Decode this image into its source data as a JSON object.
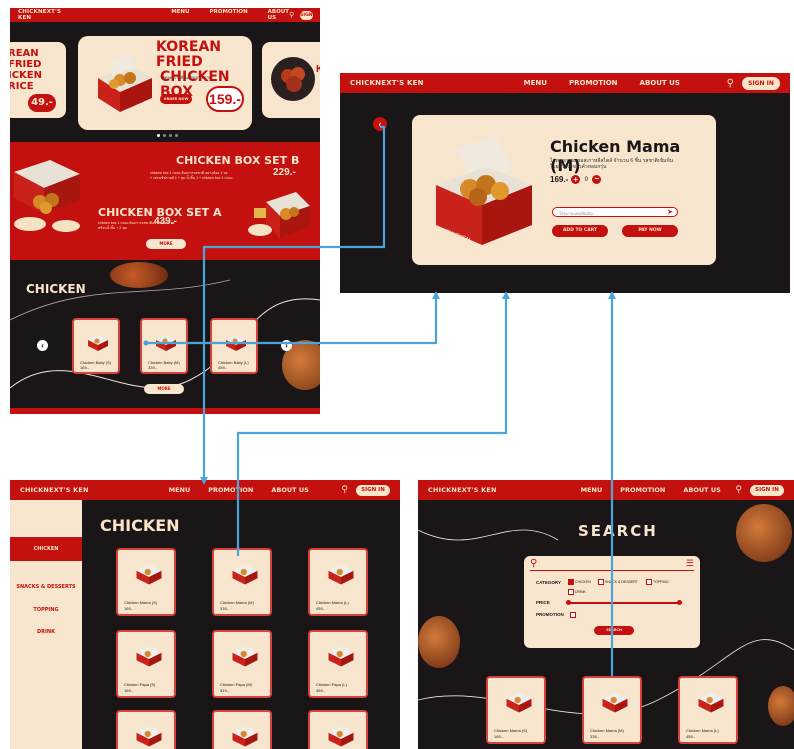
{
  "brand": "CHICKNEXT'S KEN",
  "nav_home": [
    "MENU",
    "PROMOTION",
    "ABOUT US"
  ],
  "nav": [
    "MENU",
    "PROMOTION",
    "ABOUT US"
  ],
  "signin": "SIGN IN",
  "home": {
    "hero_left": {
      "line1": "REAN FRIED",
      "line2": "ICKEN RICE",
      "price": "49.-"
    },
    "hero_main": {
      "line1": "KOREAN FRIED",
      "line2": "CHICKEN BOX",
      "sub": "ไก่ทอดเกาหลีในกล่องกระดาษ",
      "btn": "ORDER NOW",
      "price": "159.-"
    },
    "promo_b": {
      "title": "CHICKEN BOX SET B",
      "desc1": "chicken box 1 กล่อง ต้องการรสชาติ อย่างน้อย 1 รส",
      "desc2": "+ เฟรนช์ฟรายส์ 1 + ชุด น้ำจิ้ม 1 + chicken box 1 กล่อง",
      "price": "229.-"
    },
    "promo_a": {
      "title": "CHICKEN BOX SET A",
      "desc1": "chicken box 1 กล่อง ต้องการรสชาติอย่างน้อย 1 รส",
      "desc2": "พร้อมน้ำจิ้ม + 2 ชุด",
      "price": "439.-"
    },
    "more1": "MORE",
    "section": "CHICKEN",
    "cards": [
      {
        "name": "Chicken Baby (S)",
        "price": "169.-"
      },
      {
        "name": "Chicken Baby (M)",
        "price": "339.-"
      },
      {
        "name": "Chicken Baby (L)",
        "price": "459.-"
      }
    ],
    "more2": "MORE"
  },
  "detail": {
    "title": "Chicken Mama (M)",
    "desc1": "ไก่ทอดกรอบซอสเกาหลีสไตล์ จำนวน 6 ชิ้น รสชาติเข้มข้น",
    "desc2": "โรยด้วยงาขาวคั่วหอมกรุ่น",
    "price": "169.-",
    "qty": "0",
    "note_placeholder": "ใส่หมายเหตุเพิ่มเติม...",
    "add_to_cart": "ADD TO CART",
    "pay_now": "PAY NOW"
  },
  "menu_page": {
    "sidebar": [
      "CHICKEN",
      "SNACKS & DESSERTS",
      "TOPPING",
      "DRINK"
    ],
    "title": "CHICKEN",
    "items": [
      {
        "name": "Chicken Mama (S)",
        "price": "169.-"
      },
      {
        "name": "Chicken Mama (M)",
        "price": "339.-"
      },
      {
        "name": "Chicken Mama (L)",
        "price": "459.-"
      },
      {
        "name": "Chicken Papa (S)",
        "price": "169.-"
      },
      {
        "name": "Chicken Papa (M)",
        "price": "319.-"
      },
      {
        "name": "Chicken Papa (L)",
        "price": "459.-"
      }
    ]
  },
  "search_page": {
    "title": "SEARCH",
    "category_label": "CATEGORY",
    "categories": [
      "CHICKEN",
      "SNACK & DESSERT",
      "TOPPING",
      "DRINK"
    ],
    "price_label": "PRICE",
    "promotion_label": "PROMOTION",
    "btn": "SEARCH",
    "results": [
      {
        "name": "Chicken Mama (S)",
        "price": "169.-"
      },
      {
        "name": "Chicken Mama (M)",
        "price": "339.-"
      },
      {
        "name": "Chicken Mama (L)",
        "price": "459.-"
      }
    ]
  },
  "colors": {
    "red": "#c4110f",
    "cream": "#f8e5cd",
    "dark": "#1a1617",
    "connector": "#4aa4d9"
  }
}
